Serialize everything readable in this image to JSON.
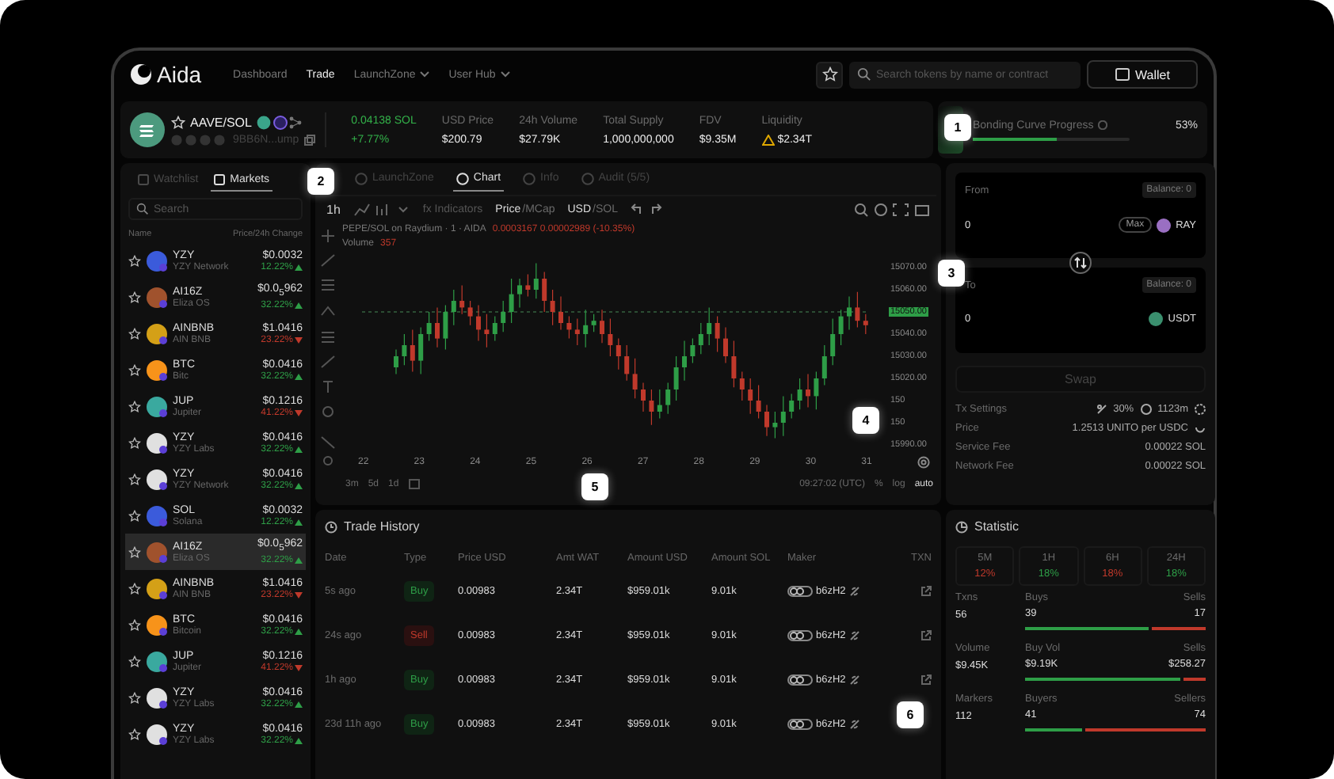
{
  "nav": {
    "logo": "Aida",
    "links": [
      {
        "label": "Dashboard",
        "selected": false,
        "dropdown": false
      },
      {
        "label": "Trade",
        "selected": true,
        "dropdown": false
      },
      {
        "label": "LaunchZone",
        "selected": false,
        "dropdown": true
      },
      {
        "label": "User Hub",
        "selected": false,
        "dropdown": true
      }
    ],
    "search": {
      "placeholder": "Search tokens by name or contract"
    },
    "wallet": "Wallet"
  },
  "token": {
    "pair": "AAVE/SOL",
    "address": "9BB6N...ump",
    "price": "0.04138 SOL",
    "change": "+7.77%",
    "stats": [
      {
        "label": "USD Price",
        "value": "$200.79",
        "warning": false
      },
      {
        "label": "24h Volume",
        "value": "$27.79K",
        "warning": false
      },
      {
        "label": "Total Supply",
        "value": "1,000,000,000",
        "warning": false
      },
      {
        "label": "FDV",
        "value": "$9.35M",
        "warning": false
      },
      {
        "label": "Liquidity",
        "value": "$2.34T",
        "warning": true
      }
    ]
  },
  "bonding": {
    "label": "Bonding Curve Progress",
    "value": "53%",
    "level": 0.53
  },
  "sidebar": {
    "tabs": [
      {
        "label": "Watchlist",
        "selected": false
      },
      {
        "label": "Markets",
        "selected": true
      }
    ],
    "search": {
      "placeholder": "Search"
    },
    "columns": [
      "Name",
      "Price/24h Change"
    ],
    "rows": [
      {
        "symbol": "YZY",
        "name": "YZY Network",
        "price": "$0.0032",
        "change": "12.22%",
        "kind": "up",
        "color": "#3b5bdb",
        "selected": false
      },
      {
        "symbol": "AI16Z",
        "name": "Eliza OS",
        "price": "$0.0$_{5}$962",
        "change": "32.22%",
        "kind": "up",
        "color": "#a0522d",
        "selected": false
      },
      {
        "symbol": "AINBNB",
        "name": "AIN BNB",
        "price": "$1.0416",
        "change": "23.22%",
        "kind": "down",
        "color": "#d4a017",
        "selected": false
      },
      {
        "symbol": "BTC",
        "name": "Bitc",
        "price": "$0.0416",
        "change": "32.22%",
        "kind": "up",
        "color": "#f7931a",
        "selected": false
      },
      {
        "symbol": "JUP",
        "name": "Jupiter",
        "price": "$0.1216",
        "change": "41.22%",
        "kind": "down",
        "color": "#3aa99f",
        "selected": false
      },
      {
        "symbol": "YZY",
        "name": "YZY Labs",
        "price": "$0.0416",
        "change": "32.22%",
        "kind": "up",
        "color": "#e0e0e0",
        "selected": false
      },
      {
        "symbol": "YZY",
        "name": "YZY Network",
        "price": "$0.0416",
        "change": "32.22%",
        "kind": "up",
        "color": "#e0e0e0",
        "selected": false
      },
      {
        "symbol": "SOL",
        "name": "Solana",
        "price": "$0.0032",
        "change": "12.22%",
        "kind": "up",
        "color": "#3b5bdb",
        "selected": false
      },
      {
        "symbol": "AI16Z",
        "name": "Eliza OS",
        "price": "$0.0$_{5}$962",
        "change": "32.22%",
        "kind": "up",
        "color": "#a0522d",
        "selected": true
      },
      {
        "symbol": "AINBNB",
        "name": "AIN BNB",
        "price": "$1.0416",
        "change": "23.22%",
        "kind": "down",
        "color": "#d4a017",
        "selected": false
      },
      {
        "symbol": "BTC",
        "name": "Bitcoin",
        "price": "$0.0416",
        "change": "32.22%",
        "kind": "up",
        "color": "#f7931a",
        "selected": false
      },
      {
        "symbol": "JUP",
        "name": "Jupiter",
        "price": "$0.1216",
        "change": "41.22%",
        "kind": "down",
        "color": "#3aa99f",
        "selected": false
      },
      {
        "symbol": "YZY",
        "name": "YZY Labs",
        "price": "$0.0416",
        "change": "32.22%",
        "kind": "up",
        "color": "#e0e0e0",
        "selected": false
      },
      {
        "symbol": "YZY",
        "name": "YZY Labs",
        "price": "$0.0416",
        "change": "32.22%",
        "kind": "up",
        "color": "#e0e0e0",
        "selected": false
      }
    ]
  },
  "chart_panel": {
    "tabs": [
      {
        "label": "LaunchZone",
        "selected": false
      },
      {
        "label": "Chart",
        "selected": true
      },
      {
        "label": "Info",
        "selected": false
      },
      {
        "label": "Audit (5/5)",
        "selected": false
      }
    ],
    "interval": "1h",
    "indicators_icon": "fx",
    "indicators": "Indicators",
    "price_mode": [
      "Price",
      "MCap"
    ],
    "currency_mode": [
      "USD",
      "SOL"
    ],
    "separator": "/",
    "legend": "PEPE/SOL on Raydium · 1 · AIDA",
    "legend_values": "0.0003167  0.00002989 (-10.35%)",
    "volume_label": "Volume",
    "volume_value": "357",
    "price_axis": [
      {
        "text": "15070.00",
        "current": false
      },
      {
        "text": "15060.00",
        "current": false
      },
      {
        "text": "15050.00",
        "current": true
      },
      {
        "text": "15040.00",
        "current": false
      },
      {
        "text": "15030.00",
        "current": false
      },
      {
        "text": "15020.00",
        "current": false
      },
      {
        "text": "150",
        "current": false
      },
      {
        "text": "150",
        "current": false
      },
      {
        "text": "15990.00",
        "current": false
      }
    ],
    "date_axis": [
      "22",
      "23",
      "24",
      "25",
      "26",
      "27",
      "28",
      "29",
      "30",
      "31"
    ],
    "ranges": [
      "3m",
      "5d",
      "1d"
    ],
    "time": "09:27:02 (UTC)",
    "scale_options": [
      "%",
      "log",
      "auto"
    ]
  },
  "swap": {
    "from": {
      "label": "From",
      "balance": "Balance: 0",
      "amount": "0",
      "max": "Max",
      "token": "RAY"
    },
    "to": {
      "label": "To",
      "balance": "Balance: 0",
      "amount": "0",
      "token": "USDT"
    },
    "button": "Swap",
    "tx_settings": {
      "label": "Tx Settings",
      "slippage": "30%",
      "time": "1123m"
    },
    "details": [
      {
        "label": "Price",
        "value": "1.2513 UNITO per USDC",
        "refresh": true
      },
      {
        "label": "Service Fee",
        "value": "0.00022 SOL",
        "refresh": false
      },
      {
        "label": "Network Fee",
        "value": "0.00022 SOL",
        "refresh": false
      }
    ]
  },
  "trade_history": {
    "title": "Trade History",
    "columns": [
      "Date",
      "Type",
      "Price USD",
      "Amt WAT",
      "Amount USD",
      "Amount SOL",
      "Maker",
      "TXN"
    ],
    "rows": [
      {
        "date": "5s ago",
        "type": "Buy",
        "kind": "buy",
        "price": "0.00983",
        "amt": "2.34T",
        "usd": "$959.01k",
        "sol": "9.01k",
        "maker": "b6zH2"
      },
      {
        "date": "24s ago",
        "type": "Sell",
        "kind": "sell",
        "price": "0.00983",
        "amt": "2.34T",
        "usd": "$959.01k",
        "sol": "9.01k",
        "maker": "b6zH2"
      },
      {
        "date": "1h ago",
        "type": "Buy",
        "kind": "buy",
        "price": "0.00983",
        "amt": "2.34T",
        "usd": "$959.01k",
        "sol": "9.01k",
        "maker": "b6zH2"
      },
      {
        "date": "23d 11h ago",
        "type": "Buy",
        "kind": "buy",
        "price": "0.00983",
        "amt": "2.34T",
        "usd": "$959.01k",
        "sol": "9.01k",
        "maker": "b6zH2"
      }
    ]
  },
  "statistic": {
    "title": "Statistic",
    "periods": [
      {
        "label": "5M",
        "value": "12%",
        "kind": "down"
      },
      {
        "label": "1H",
        "value": "18%",
        "kind": "up"
      },
      {
        "label": "6H",
        "value": "18%",
        "kind": "down"
      },
      {
        "label": "24H",
        "value": "18%",
        "kind": "up"
      }
    ],
    "rows": [
      {
        "label": "Txns",
        "value": "56",
        "left_label": "Buys",
        "left_value": "39",
        "right_label": "Sells",
        "right_value": "17",
        "level": 0.7
      },
      {
        "label": "Volume",
        "value": "$9.45K",
        "left_label": "Buy Vol",
        "left_value": "$9.19K",
        "right_label": "Sells",
        "right_value": "$258.27",
        "level": 0.88
      },
      {
        "label": "Markers",
        "value": "112",
        "left_label": "Buyers",
        "left_value": "41",
        "right_label": "Sellers",
        "right_value": "74",
        "level": 0.33
      }
    ]
  },
  "callouts": [
    "1",
    "2",
    "3",
    "4",
    "5",
    "6"
  ]
}
